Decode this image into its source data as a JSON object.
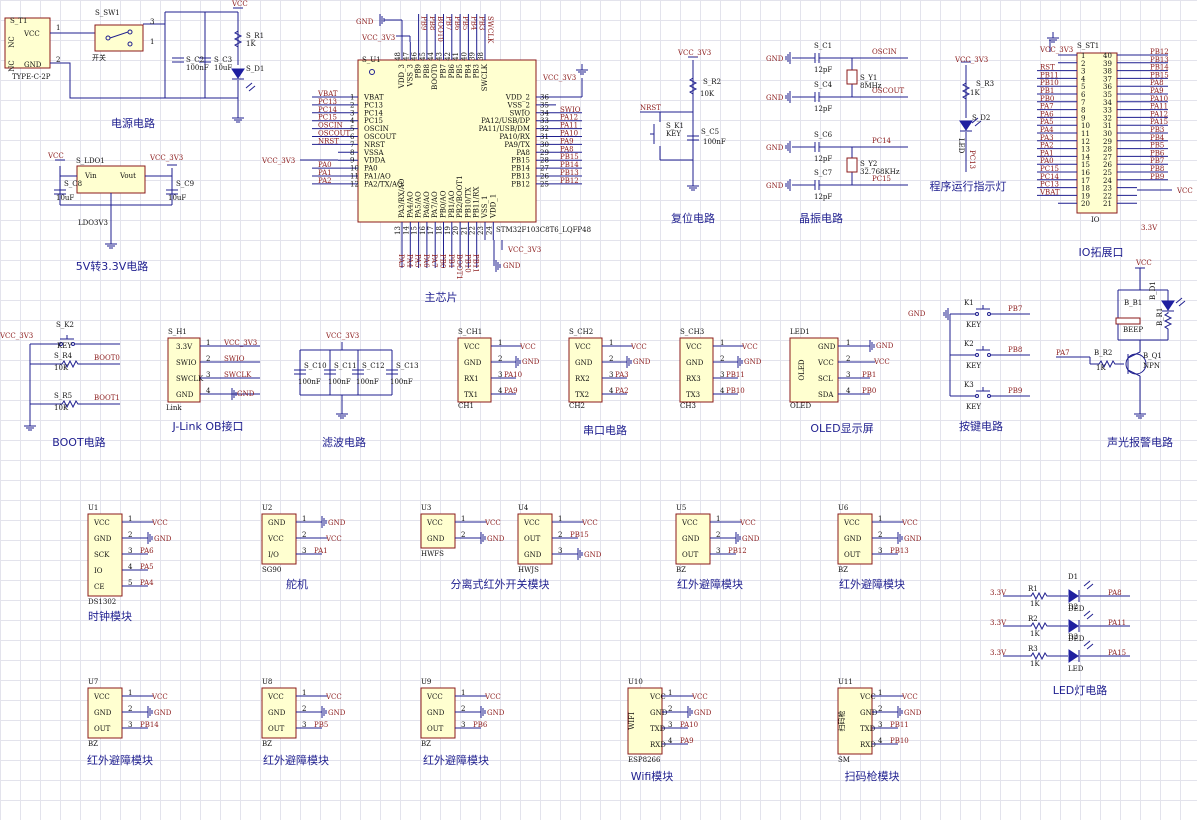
{
  "sections": {
    "power": "电源电路",
    "ldo": "5V转3.3V电路",
    "mcu": "主芯片",
    "reset": "复位电路",
    "crystal": "晶振电路",
    "led_ind": "程序运行指示灯",
    "io": "IO拓展口",
    "boot": "BOOT电路",
    "jlink": "J-Link OB接口",
    "filter": "滤波电路",
    "uart": "串口电路",
    "oled": "OLED显示屏",
    "keys": "按键电路",
    "alarm": "声光报警电路",
    "clock": "时钟模块",
    "servo": "舵机",
    "ir_switch": "分离式红外开关模块",
    "ir_avoid": "红外避障模块",
    "led_circuit": "LED灯电路",
    "wifi": "Wifi模块",
    "scanner": "扫码枪模块"
  },
  "labels": {
    "vcc": "VCC",
    "gnd": "GND",
    "vcc33": "VCC_3V3",
    "v33": "3.3V",
    "typec": "TYPE-C-2P",
    "st1": "S_T1",
    "sw1": "S_SW1",
    "switch": "开关",
    "c2": "S_C2",
    "c3": "S_C3",
    "r1": "S_R1",
    "d1": "S_D1",
    "c2v": "100nF",
    "c3v": "10uF",
    "r1v": "1K",
    "ldo1": "S_LDO1",
    "ldo_part": "LDO3V3",
    "vin": "Vin",
    "vout": "Vout",
    "c8": "S_C8",
    "c9": "S_C9",
    "uf10": "10uF",
    "u1": "S_U1",
    "mcu_part": "STM32F103C8T6_LQFP48",
    "nrst": "NRST",
    "k1": "S_K1",
    "key": "KEY",
    "r2": "S_R2",
    "k10": "10K",
    "c5": "S_C5",
    "nf100": "100nF",
    "c1": "S_C1",
    "c4": "S_C4",
    "c6": "S_C6",
    "c7": "S_C7",
    "pf12": "12pF",
    "y1": "S_Y1",
    "y2": "S_Y2",
    "mhz8": "8MHz",
    "khz": "32.768KHz",
    "oscin": "OSCIN",
    "oscout": "OSCOUT",
    "pc14": "PC14",
    "pc15": "PC15",
    "r3": "S_R3",
    "d2": "S_D2",
    "k1v": "1K",
    "led": "LED",
    "pc13": "PC13",
    "st1io": "S_ST1",
    "io": "IO",
    "k2": "S_K2",
    "r4": "S_R4",
    "r5": "S_R5",
    "boot0": "BOOT0",
    "boot1": "BOOT1",
    "h1": "S_H1",
    "link": "Link",
    "swio": "SWIO",
    "swclk": "SWCLK",
    "c10": "S_C10",
    "c11": "S_C11",
    "c12": "S_C12",
    "c13": "S_C13",
    "ch1": "S_CH1",
    "ch2": "S_CH2",
    "ch3": "S_CH3",
    "led1": "LED1",
    "oled": "OLED",
    "scl": "SCL",
    "sda": "SDA",
    "k1b": "K1",
    "k2b": "K2",
    "k3b": "K3",
    "bb1": "B_B1",
    "beep": "BEEP",
    "br2": "B_R2",
    "bq1": "B_Q1",
    "npn": "NPN",
    "bd1": "B_D1",
    "br1": "B_R1",
    "pa7": "PA7",
    "ds1302": "DS1302",
    "sg90": "SG90",
    "hwfs": "HWFS",
    "hwjs": "HWJS",
    "bz": "BZ",
    "esp": "ESP8266",
    "sm": "SM",
    "wifi_in": "WIFI",
    "scan_in": "扫码枪",
    "nc": "NC",
    "kbd": "KEY",
    "tx": "TX",
    "rx": "RX",
    "txd": "TXD",
    "rxd": "RXD",
    "out": "OUT",
    "io_pin": "I/O",
    "sck": "SCK",
    "ce": "CE",
    "io2": "IO"
  },
  "mcu_left": [
    "VBAT",
    "PC13",
    "PC14",
    "PC15",
    "OSCIN",
    "OSCOUT",
    "NRST",
    "VSSA",
    "VDDA",
    "PA0",
    "PA1/AO",
    "PA2/TX/AO"
  ],
  "mcu_left_nets": [
    "VBAT",
    "PC13",
    "PC14",
    "PC15",
    "OSCIN",
    "OSCOUT",
    "NRST",
    "",
    "",
    "PA0",
    "PA1",
    "PA2"
  ],
  "mcu_right": [
    "VDD_2",
    "VSS_2",
    "SWIO",
    "PA12/USB/DP",
    "PA11/USB/DM",
    "PA10/RX",
    "PA9/TX",
    "PA8",
    "PB15",
    "PB14",
    "PB13",
    "PB12"
  ],
  "mcu_right_nets": [
    "",
    "",
    "SWIO",
    "PA12",
    "PA11",
    "PA10",
    "PA9",
    "PA8",
    "PB15",
    "PB14",
    "PB13",
    "PB12"
  ],
  "mcu_top": [
    "VDD_3",
    "VSS_3",
    "PB9",
    "PB8",
    "BOOT0",
    "PB7",
    "PB6",
    "PB5",
    "PB4",
    "PB3",
    "SWCLK"
  ],
  "mcu_top_nets": [
    "GND",
    "VCC_3V3",
    "PB9",
    "PB8",
    "BOOT0",
    "PB7",
    "PB6",
    "PB5",
    "PB4",
    "PB3",
    "SWCLK"
  ],
  "mcu_bottom": [
    "PA3/RX/AO",
    "PA4/AO",
    "PA5/AO",
    "PA6/AO",
    "PA7/AO",
    "PB0/AO",
    "PB1/AO",
    "PB2/BOOT1",
    "PB10/TX",
    "PB11/RX",
    "VSS_1",
    "VDD_1"
  ],
  "mcu_bottom_nets": [
    "PA3",
    "PA4",
    "PA5",
    "PA6",
    "PA7",
    "PB0",
    "PB1",
    "BOOT1",
    "PB10",
    "PB11",
    "",
    ""
  ],
  "io_left": [
    "",
    "",
    "RST",
    "PB11",
    "PB10",
    "PB1",
    "PB0",
    "PA7",
    "PA6",
    "PA5",
    "PA4",
    "PA3",
    "PA2",
    "PA1",
    "PA0",
    "PC15",
    "PC14",
    "PC13",
    "VBAT"
  ],
  "io_right": [
    "PB12",
    "PB13",
    "PB14",
    "PB15",
    "PA8",
    "PA9",
    "PA10",
    "PA11",
    "PA12",
    "PA15",
    "PB3",
    "PB4",
    "PB5",
    "PB6",
    "PB7",
    "PB8",
    "PB9",
    "",
    "",
    ""
  ],
  "modules": [
    {
      "id": "U1",
      "part": "DS1302",
      "title": "时钟模块",
      "pins": [
        "VCC",
        "GND",
        "SCK",
        "IO",
        "CE"
      ],
      "nets": [
        "VCC",
        "GND",
        "PA6",
        "PA5",
        "PA4"
      ]
    },
    {
      "id": "U2",
      "part": "SG90",
      "title": "舵机",
      "pins": [
        "GND",
        "VCC",
        "I/O"
      ],
      "nets": [
        "GND",
        "VCC",
        "PA1"
      ]
    },
    {
      "id": "U3",
      "part": "HWFS",
      "title": "分离式红外开关模块",
      "pins": [
        "VCC",
        "GND"
      ],
      "nets": [
        "VCC",
        "GND"
      ]
    },
    {
      "id": "U4",
      "part": "HWJS",
      "title": "",
      "pins": [
        "VCC",
        "OUT",
        "GND"
      ],
      "nets": [
        "VCC",
        "PB15",
        "GND"
      ]
    },
    {
      "id": "U5",
      "part": "BZ",
      "title": "红外避障模块",
      "pins": [
        "VCC",
        "GND",
        "OUT"
      ],
      "nets": [
        "VCC",
        "GND",
        "PB12"
      ]
    },
    {
      "id": "U6",
      "part": "BZ",
      "title": "红外避障模块",
      "pins": [
        "VCC",
        "GND",
        "OUT"
      ],
      "nets": [
        "VCC",
        "GND",
        "PB13"
      ]
    },
    {
      "id": "U7",
      "part": "BZ",
      "title": "红外避障模块",
      "pins": [
        "VCC",
        "GND",
        "OUT"
      ],
      "nets": [
        "VCC",
        "GND",
        "PB14"
      ]
    },
    {
      "id": "U8",
      "part": "BZ",
      "title": "红外避障模块",
      "pins": [
        "VCC",
        "GND",
        "OUT"
      ],
      "nets": [
        "VCC",
        "GND",
        "PB5"
      ]
    },
    {
      "id": "U9",
      "part": "BZ",
      "title": "红外避障模块",
      "pins": [
        "VCC",
        "GND",
        "OUT"
      ],
      "nets": [
        "VCC",
        "GND",
        "PB6"
      ]
    },
    {
      "id": "U10",
      "part": "ESP8266",
      "title": "Wifi模块",
      "pins": [
        "VCC",
        "GND",
        "TXD",
        "RXD"
      ],
      "nets": [
        "VCC",
        "GND",
        "PA10",
        "PA9"
      ]
    },
    {
      "id": "U11",
      "part": "SM",
      "title": "扫码枪模块",
      "pins": [
        "VCC",
        "GND",
        "TXD",
        "RXD"
      ],
      "nets": [
        "VCC",
        "GND",
        "PB11",
        "PB10"
      ]
    }
  ],
  "uarts": [
    {
      "id": "S_CH1",
      "part": "CH1",
      "pins": [
        "VCC",
        "GND",
        "RX1",
        "TX1"
      ],
      "nets": [
        "VCC",
        "GND",
        "PA10",
        "PA9"
      ]
    },
    {
      "id": "S_CH2",
      "part": "CH2",
      "pins": [
        "VCC",
        "GND",
        "RX2",
        "TX2"
      ],
      "nets": [
        "VCC",
        "GND",
        "PA3",
        "PA2"
      ]
    },
    {
      "id": "S_CH3",
      "part": "CH3",
      "pins": [
        "VCC",
        "GND",
        "RX3",
        "TX3"
      ],
      "nets": [
        "VCC",
        "GND",
        "PB11",
        "PB10"
      ]
    }
  ],
  "jlink_pins": [
    "3.3V",
    "SWIO",
    "SWCLK",
    "GND"
  ],
  "jlink_nets": [
    "VCC_3V3",
    "SWIO",
    "SWCLK",
    "GND"
  ],
  "oled_pins": [
    "GND",
    "VCC",
    "SCL",
    "SDA"
  ],
  "oled_nets": [
    "GND",
    "VCC",
    "PB1",
    "PB0"
  ],
  "keys": [
    {
      "ref": "K1",
      "net": "PB7"
    },
    {
      "ref": "K2",
      "net": "PB8"
    },
    {
      "ref": "K3",
      "net": "PB9"
    }
  ],
  "leds": [
    {
      "r": "R1",
      "d": "D1",
      "net": "PA8",
      "dl": "DED"
    },
    {
      "r": "R2",
      "d": "D2",
      "net": "PA11",
      "dl": "DED"
    },
    {
      "r": "R3",
      "d": "D3",
      "net": "PA15",
      "dl": "LED"
    }
  ],
  "filter_caps": [
    "S_C10",
    "S_C11",
    "S_C12",
    "S_C13"
  ]
}
